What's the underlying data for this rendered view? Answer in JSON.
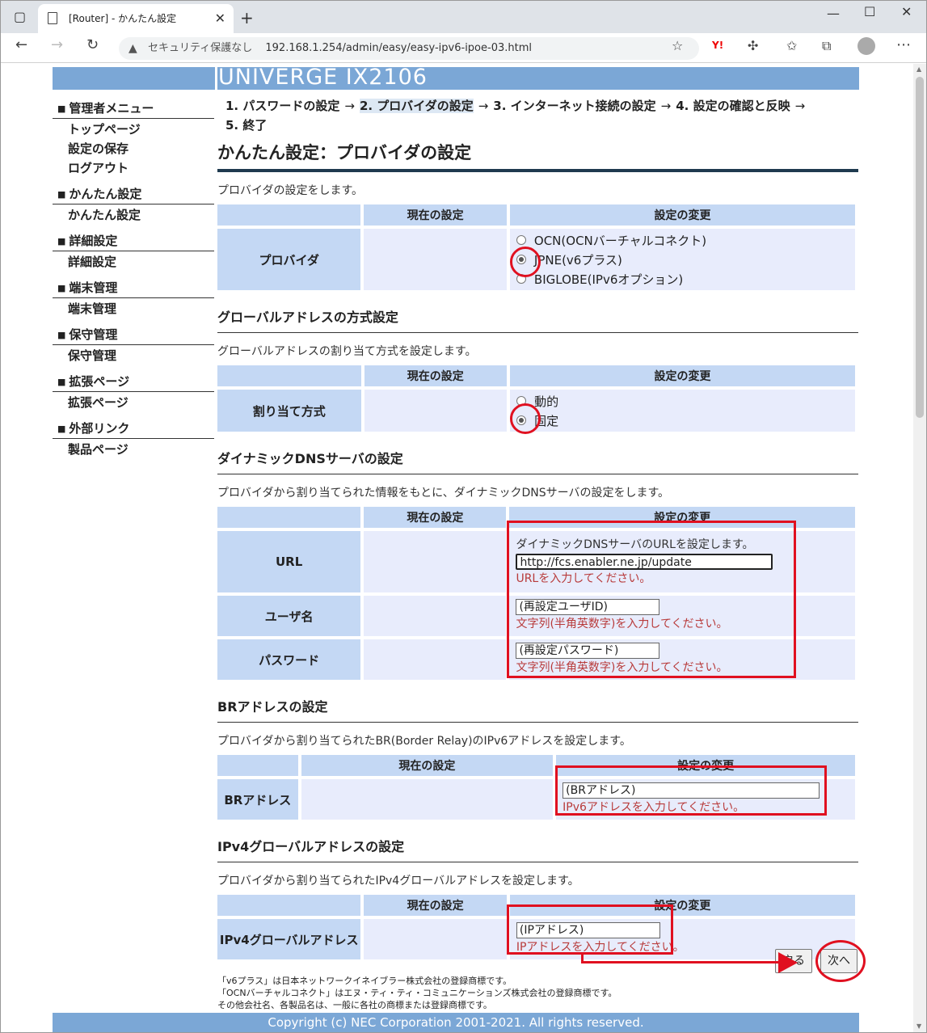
{
  "browser": {
    "tab_title": "[Router] - かんたん設定",
    "security_label": "セキュリティ保護なし",
    "address": "192.168.1.254/admin/easy/easy-ipv6-ipoe-03.html"
  },
  "banner": {
    "product": "UNIVERGE IX2106"
  },
  "sidebar": {
    "groups": [
      {
        "title": "管理者メニュー",
        "items": [
          "トップページ",
          "設定の保存",
          "ログアウト"
        ]
      },
      {
        "title": "かんたん設定",
        "items": [
          "かんたん設定"
        ]
      },
      {
        "title": "詳細設定",
        "items": [
          "詳細設定"
        ]
      },
      {
        "title": "端末管理",
        "items": [
          "端末管理"
        ]
      },
      {
        "title": "保守管理",
        "items": [
          "保守管理"
        ]
      },
      {
        "title": "拡張ページ",
        "items": [
          "拡張ページ"
        ]
      },
      {
        "title": "外部リンク",
        "items": [
          "製品ページ"
        ]
      }
    ]
  },
  "steps": {
    "s1": "1. パスワードの設定",
    "s2": "2. プロバイダの設定",
    "s3": "3. インターネット接続の設定",
    "s4": "4. 設定の確認と反映",
    "s5": "5. 終了",
    "arrow": "→"
  },
  "page_title": "かんたん設定：プロバイダの設定",
  "columns": {
    "current": "現在の設定",
    "change": "設定の変更"
  },
  "provider": {
    "desc": "プロバイダの設定をします。",
    "label": "プロバイダ",
    "options": [
      "OCN(OCNバーチャルコネクト)",
      "JPNE(v6プラス)",
      "BIGLOBE(IPv6オプション)"
    ],
    "selected_index": 1
  },
  "global_addr": {
    "heading": "グローバルアドレスの方式設定",
    "desc": "グローバルアドレスの割り当て方式を設定します。",
    "label": "割り当て方式",
    "options": [
      "動的",
      "固定"
    ],
    "selected_index": 1
  },
  "ddns": {
    "heading": "ダイナミックDNSサーバの設定",
    "desc": "プロバイダから割り当てられた情報をもとに、ダイナミックDNSサーバの設定をします。",
    "url_label": "URL",
    "url_hint": "ダイナミックDNSサーバのURLを設定します。",
    "url_value": "http://fcs.enabler.ne.jp/update",
    "url_note": "URLを入力してください。",
    "user_label": "ユーザ名",
    "user_value": "(再設定ユーザID)",
    "user_note": "文字列(半角英数字)を入力してください。",
    "pass_label": "パスワード",
    "pass_value": "(再設定パスワード)",
    "pass_note": "文字列(半角英数字)を入力してください。"
  },
  "br": {
    "heading": "BRアドレスの設定",
    "desc": "プロバイダから割り当てられたBR(Border Relay)のIPv6アドレスを設定します。",
    "label": "BRアドレス",
    "value": "(BRアドレス)",
    "note": "IPv6アドレスを入力してください。"
  },
  "ipv4": {
    "heading": "IPv4グローバルアドレスの設定",
    "desc": "プロバイダから割り当てられたIPv4グローバルアドレスを設定します。",
    "label": "IPv4グローバルアドレス",
    "value": "(IPアドレス)",
    "note": "IPアドレスを入力してください。"
  },
  "buttons": {
    "back": "戻る",
    "next": "次へ"
  },
  "footnotes": [
    "「v6プラス」は日本ネットワークイネイブラー株式会社の登録商標です。",
    "「OCNバーチャルコネクト」はエヌ・ティ・ティ・コミュニケーションズ株式会社の登録商標です。",
    "その他会社名、各製品名は、一般に各社の商標または登録商標です。"
  ],
  "copyright": "Copyright (c) NEC Corporation 2001-2021. All rights reserved.",
  "annotation_color": "#e01020"
}
